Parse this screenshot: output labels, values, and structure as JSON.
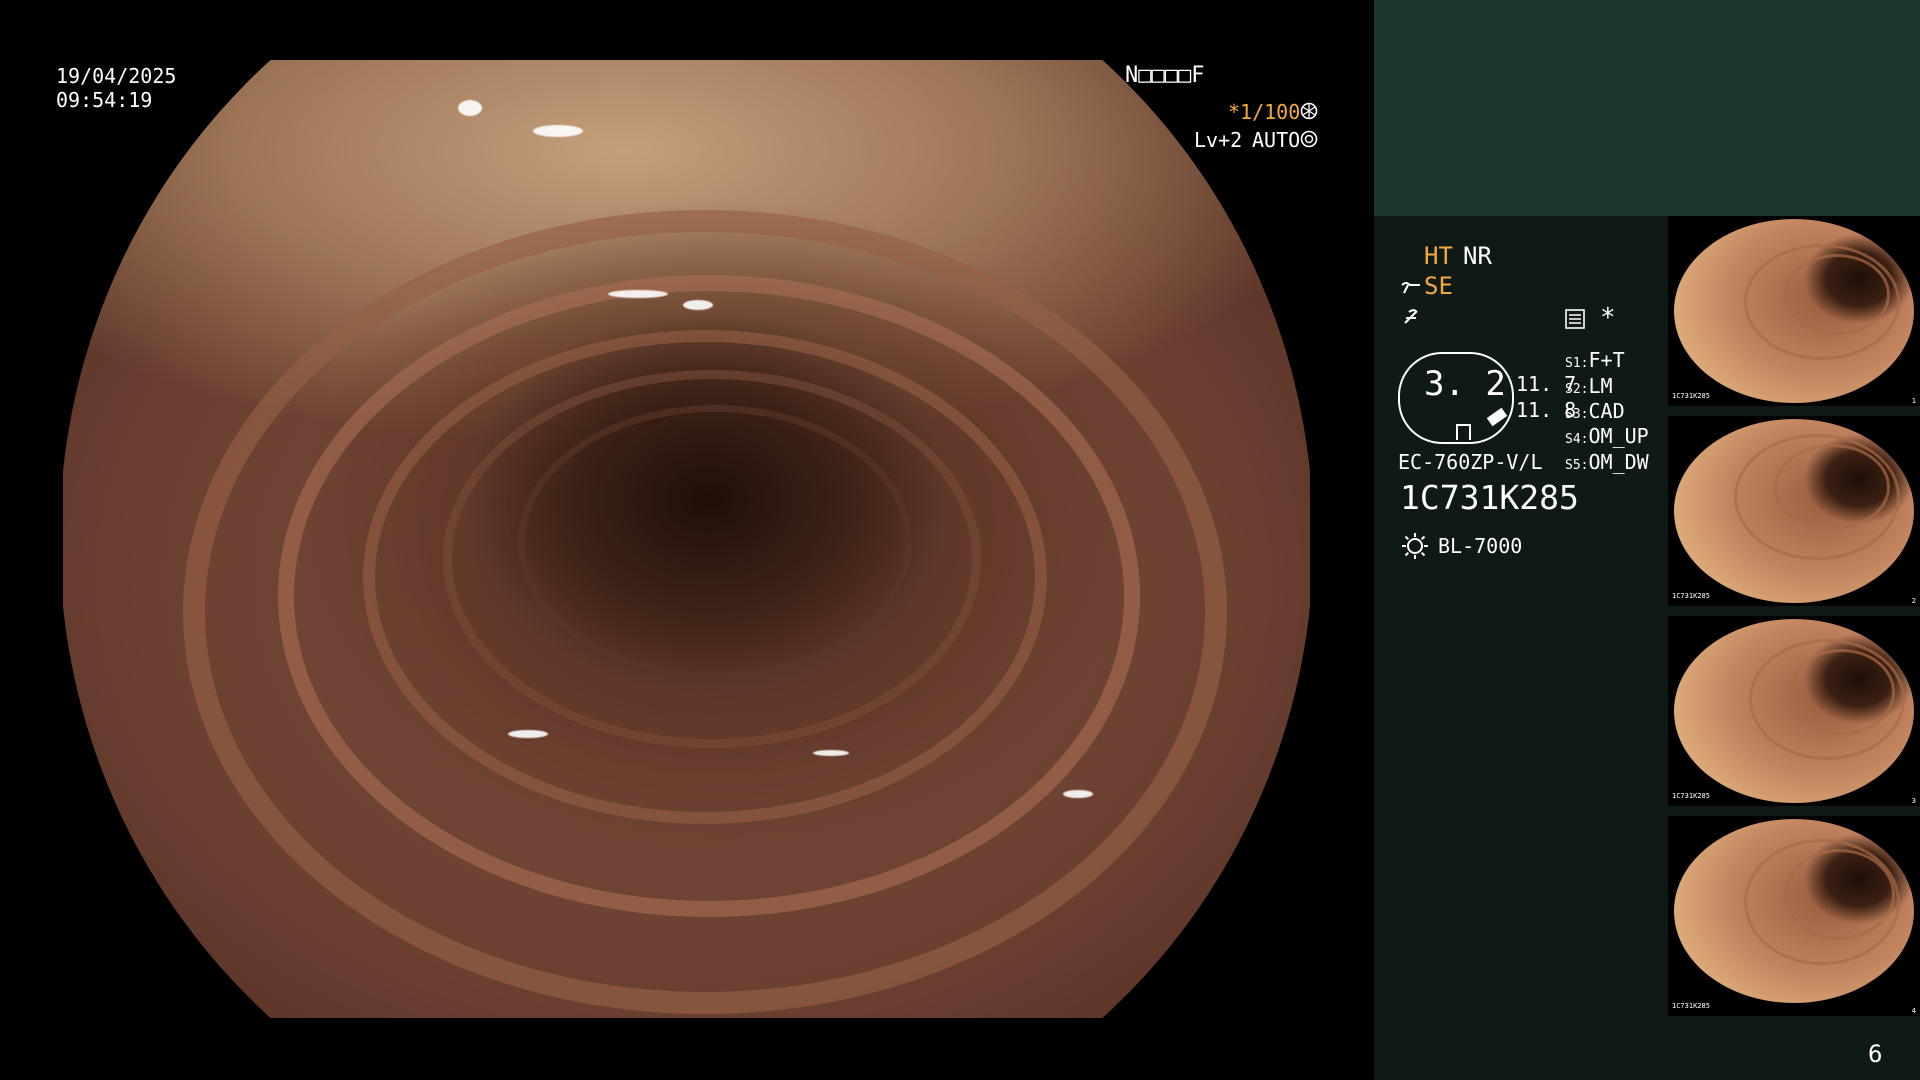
{
  "view": {
    "date": "19/04/2025",
    "time": "09:54:19",
    "patient_code": "N□□□□F",
    "shutter": "*1/100",
    "level": "Lv+2",
    "mode": "AUTO"
  },
  "panel": {
    "modes": [
      "HT",
      "NR",
      "SE"
    ],
    "zoom_value": "3. 2",
    "readout_top": "11. 7",
    "readout_bottom": "11. 8",
    "scope_model": "EC-760ZP-V/L",
    "serial": "1C731K285",
    "light_source": "BL-7000",
    "asterisk": "*",
    "switches": [
      {
        "key": "S1:",
        "value": "F+T"
      },
      {
        "key": "S2:",
        "value": "LM"
      },
      {
        "key": "S3:",
        "value": "CAD"
      },
      {
        "key": "S4:",
        "value": "OM_UP"
      },
      {
        "key": "S5:",
        "value": "OM_DW"
      }
    ],
    "page_number": "6"
  },
  "thumbnails": [
    {
      "label": "1C731K285",
      "index": "1"
    },
    {
      "label": "1C731K285",
      "index": "2"
    },
    {
      "label": "1C731K285",
      "index": "3"
    },
    {
      "label": "1C731K285",
      "index": "4"
    }
  ],
  "colors": {
    "accent_orange": "#f4a93a",
    "panel_dark": "#0f1a17",
    "panel_top": "#1d3630"
  }
}
